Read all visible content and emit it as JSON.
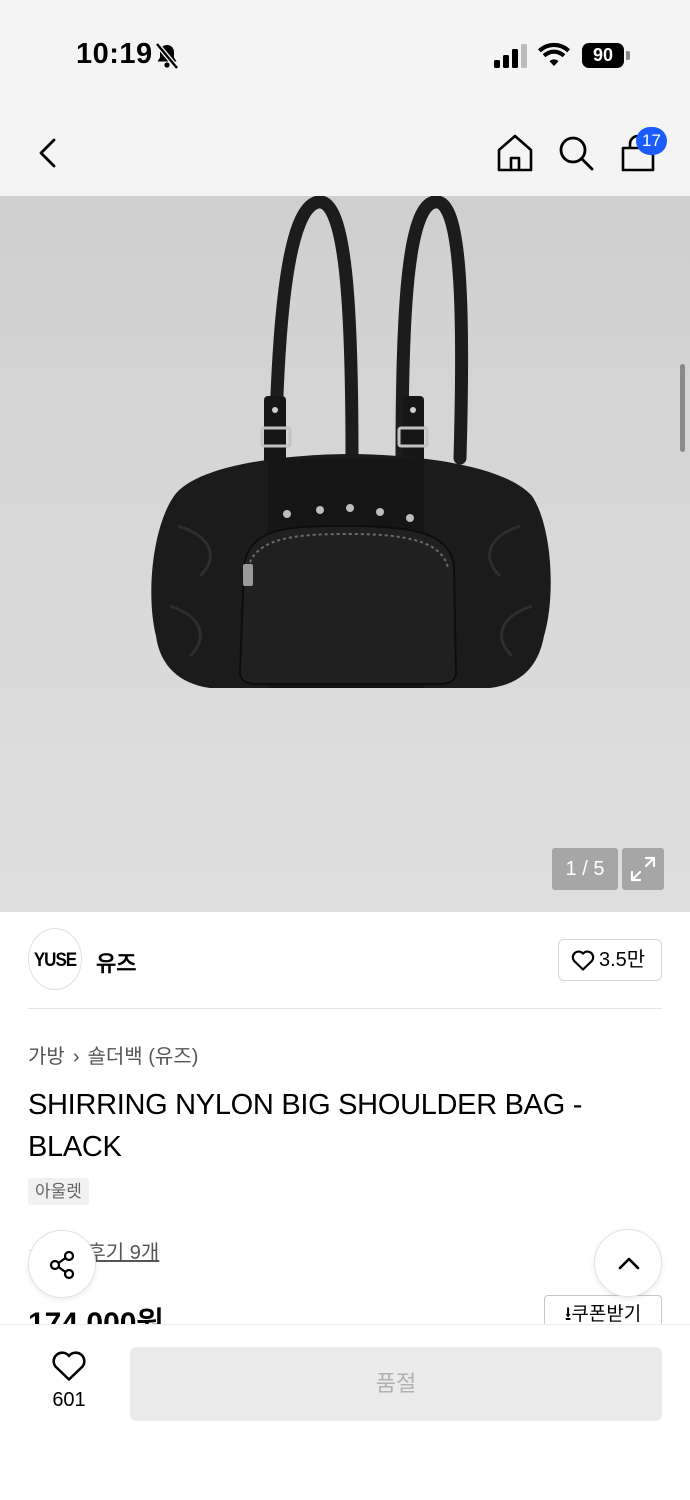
{
  "status_bar": {
    "time": "10:19",
    "battery": "90"
  },
  "nav": {
    "cart_count": "17"
  },
  "gallery": {
    "counter": "1 / 5"
  },
  "brand": {
    "logo_text": "YUSE",
    "name": "유즈",
    "likes": "3.5만"
  },
  "breadcrumb": {
    "category": "가방",
    "separator": "›",
    "subcategory": "숄더백 (유즈)"
  },
  "product": {
    "title": "SHIRRING NYLON BIG SHOULDER BAG - BLACK",
    "tag": "아울렛",
    "review_text": "후기 9개",
    "price": "174,000원"
  },
  "coupon": {
    "label": "⭳쿠폰받기"
  },
  "bottom": {
    "wish_count": "601",
    "buy_label": "품절"
  },
  "colors": {
    "accent": "#1a5cff",
    "star": "#f5a623",
    "soldout_bg": "#ebebeb"
  }
}
